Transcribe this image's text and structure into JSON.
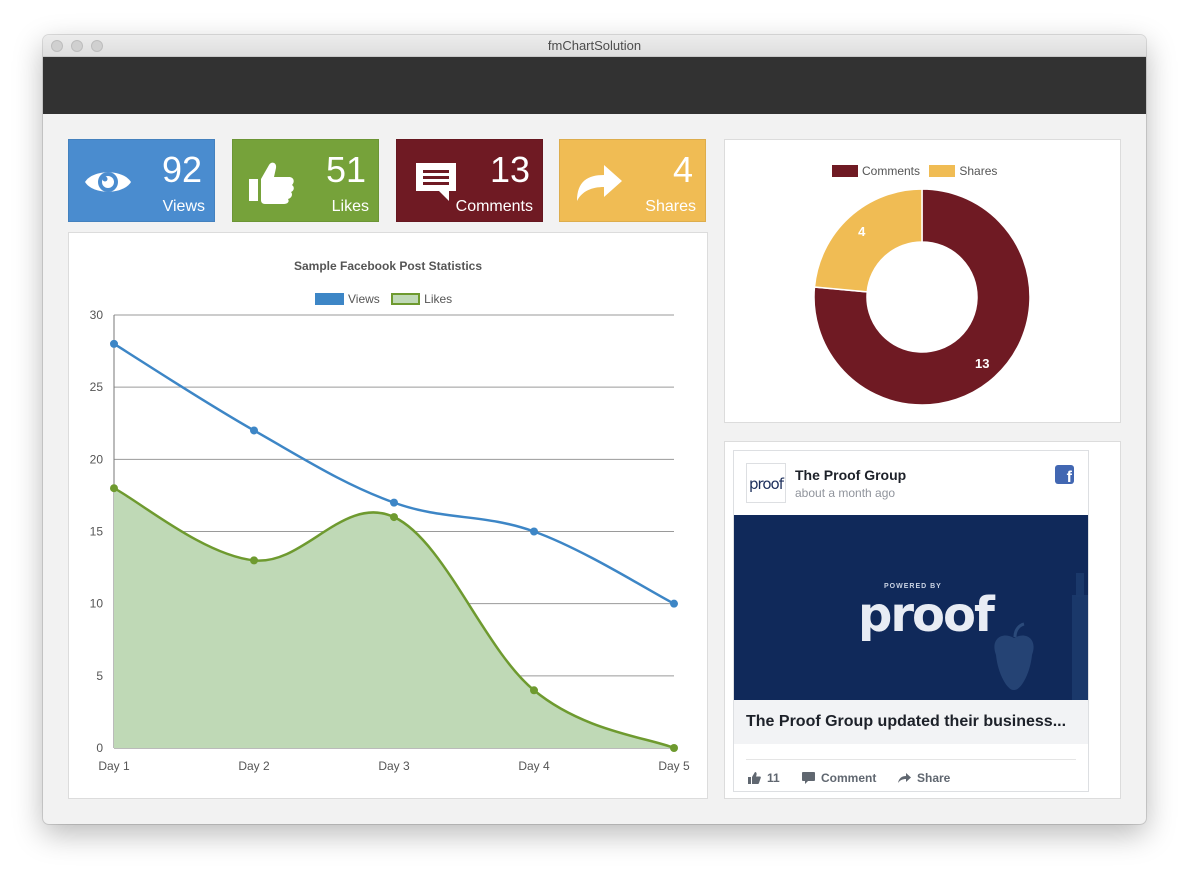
{
  "window": {
    "title": "fmChartSolution"
  },
  "tiles": [
    {
      "label": "Views",
      "value": "92",
      "icon": "eye-icon",
      "color": "#4a8ccf"
    },
    {
      "label": "Likes",
      "value": "51",
      "icon": "thumbs-up-icon",
      "color": "#76a23a"
    },
    {
      "label": "Comments",
      "value": "13",
      "icon": "comment-icon",
      "color": "#6f1a23"
    },
    {
      "label": "Shares",
      "value": "4",
      "icon": "share-arrow-icon",
      "color": "#f0bc54"
    }
  ],
  "chart_data": [
    {
      "type": "line",
      "title": "Sample Facebook Post Statistics",
      "categories": [
        "Day 1",
        "Day 2",
        "Day 3",
        "Day 4",
        "Day 5"
      ],
      "series": [
        {
          "name": "Views",
          "values": [
            28,
            22,
            17,
            15,
            10
          ],
          "color": "#3d86c6",
          "fill": false
        },
        {
          "name": "Likes",
          "values": [
            18,
            13,
            16,
            4,
            0
          ],
          "color": "#6e9a2f",
          "fill": true,
          "fill_color": "#bfd9b6"
        }
      ],
      "ylim": [
        0,
        30
      ],
      "yticks": [
        "0",
        "5",
        "10",
        "15",
        "20",
        "25",
        "30"
      ],
      "grid": true,
      "legend": "top"
    },
    {
      "type": "pie",
      "variant": "doughnut",
      "labels": [
        "Comments",
        "Shares"
      ],
      "values": [
        13,
        4
      ],
      "colors": [
        "#6f1a23",
        "#f0bc54"
      ],
      "legend": "top"
    }
  ],
  "post": {
    "page_name": "The Proof Group",
    "time": "about a month ago",
    "avatar_text": "proof",
    "image_small_text": "POWERED BY",
    "image_big_text": "proof",
    "caption": "The Proof Group updated their business...",
    "likes": "11",
    "comment_label": "Comment",
    "share_label": "Share",
    "fb_glyph": "f"
  }
}
